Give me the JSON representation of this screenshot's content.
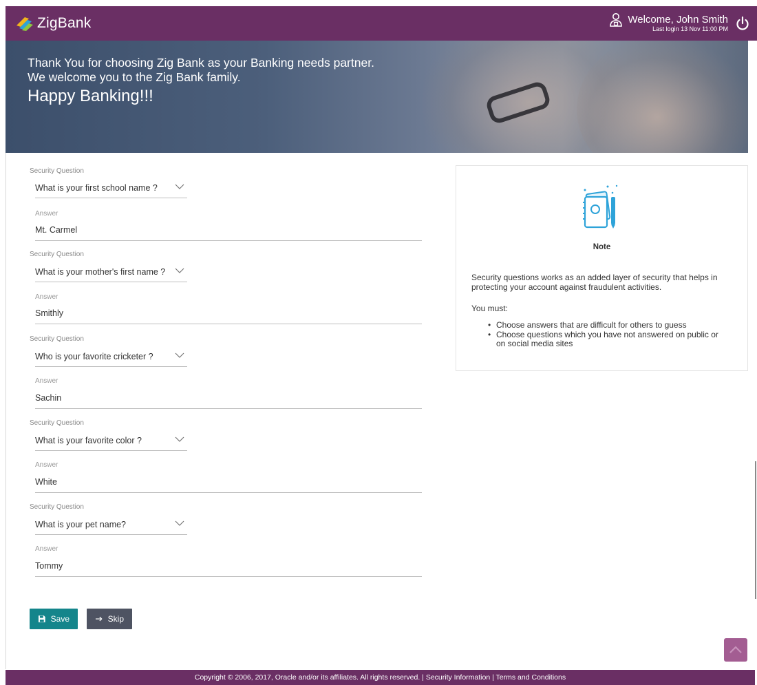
{
  "header": {
    "brand": "ZigBank",
    "welcome": "Welcome, John Smith",
    "last_login": "Last login 13 Nov 11:00 PM"
  },
  "banner": {
    "line1": "Thank You for choosing Zig Bank as your Banking needs partner.",
    "line2": "We welcome you to the Zig Bank family.",
    "line3": "Happy Banking!!!"
  },
  "form": {
    "items": [
      {
        "question_label": "Security Question",
        "question": "What is your first school name ?",
        "answer_label": "Answer",
        "answer": "Mt. Carmel"
      },
      {
        "question_label": "Security Question",
        "question": "What is your mother's first name ?",
        "answer_label": "Answer",
        "answer": "Smithly"
      },
      {
        "question_label": "Security Question",
        "question": "Who is your favorite cricketer ?",
        "answer_label": "Answer",
        "answer": "Sachin"
      },
      {
        "question_label": "Security Question",
        "question": "What is your favorite color ?",
        "answer_label": "Answer",
        "answer": "White"
      },
      {
        "question_label": "Security Question",
        "question": "What is your pet name?",
        "answer_label": "Answer",
        "answer": "Tommy"
      }
    ],
    "save_label": "Save",
    "skip_label": "Skip"
  },
  "note": {
    "title": "Note",
    "description": "Security questions works as an added layer of security that helps in protecting your account against fraudulent activities.",
    "must": "You must:",
    "bullets": [
      "Choose answers that are difficult for others to guess",
      "Choose questions which you have not answered on public or on social media sites"
    ]
  },
  "footer": {
    "text": "Copyright © 2006, 2017, Oracle and/or its affiliates. All rights reserved. | Security Information | Terms and Conditions"
  },
  "colors": {
    "header_bg": "#6a2f64",
    "save_btn": "#14858b",
    "skip_btn": "#4e5362",
    "scroll_top": "#a35d92"
  },
  "icons": {
    "logo": "zigbank-logo-icon",
    "user": "user-icon",
    "power": "power-icon",
    "chevron": "chevron-down-icon",
    "save": "floppy-disk-icon",
    "skip": "arrow-right-icon",
    "note": "notebook-illustration-icon",
    "scroll": "chevron-up-icon"
  }
}
